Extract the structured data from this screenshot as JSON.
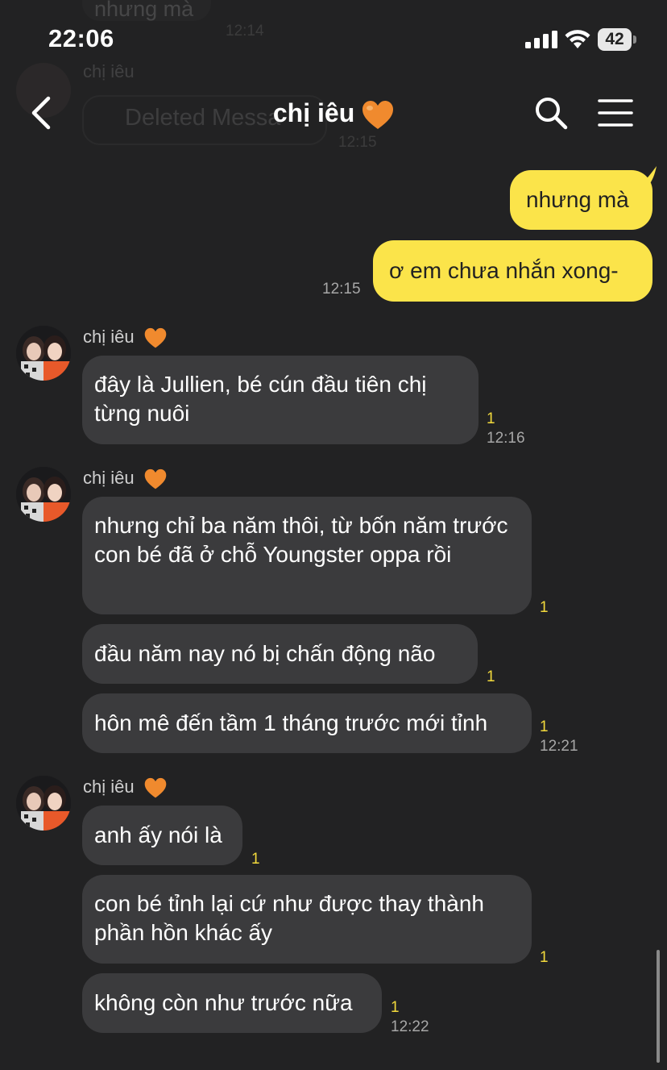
{
  "status_bar": {
    "time": "22:06",
    "battery": "42"
  },
  "header": {
    "title": "chị iêu 🧡",
    "title_name": "chị iêu"
  },
  "ghost": {
    "text1": "nhưng mà",
    "time1": "12:14",
    "name": "chị iêu",
    "deleted": "Deleted Messa",
    "time2": "12:15"
  },
  "messages": {
    "out1": "nhưng mà",
    "out2": "ơ em chưa nhắn xong-",
    "out_time": "12:15",
    "group1": {
      "sender": "chị iêu",
      "m1": "đây là Jullien, bé cún đầu tiên chị từng nuôi",
      "m1_read": "1",
      "time": "12:16"
    },
    "group2": {
      "sender": "chị iêu",
      "m1": "nhưng chỉ ba năm thôi, từ bốn năm trước con bé đã ở chỗ Youngster oppa rồi",
      "m1_read": "1",
      "m2": "đầu năm nay nó bị chấn động não",
      "m2_read": "1",
      "m3": "hôn mê đến tầm 1 tháng trước mới tỉnh",
      "m3_read": "1",
      "time": "12:21"
    },
    "group3": {
      "sender": "chị iêu",
      "m1": "anh ấy nói là",
      "m1_read": "1",
      "m2": "con bé tỉnh lại cứ như được thay thành phần hồn khác ấy",
      "m2_read": "1",
      "m3": "không còn như trước nữa",
      "m3_read": "1",
      "time": "12:22"
    }
  },
  "colors": {
    "background": "#222223",
    "outgoing": "#fbe44a",
    "incoming": "#3b3b3d",
    "read_count": "#f2d93c"
  },
  "icons": [
    "signal-icon",
    "wifi-icon",
    "battery-icon",
    "back-icon",
    "search-icon",
    "menu-icon",
    "heart-icon"
  ]
}
